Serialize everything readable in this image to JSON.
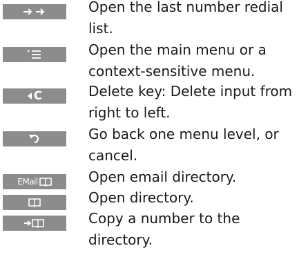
{
  "rows": [
    {
      "key_icon": "redial-arrows-icon",
      "description": "Open the last number redial list."
    },
    {
      "key_icon": "menu-icon",
      "description": "Open the main menu or a context-sensitive menu."
    },
    {
      "key_icon": "delete-key-icon",
      "key_label": "C",
      "description": "Delete key: Delete input from right to left."
    },
    {
      "key_icon": "back-arrow-icon",
      "description": "Go back one menu level, or cancel."
    },
    {
      "key_icon": "email-directory-book-icon",
      "key_label": "EMail",
      "description": "Open email directory."
    },
    {
      "key_icon": "directory-book-icon",
      "description": "Open directory."
    },
    {
      "key_icon": "copy-to-directory-icon",
      "description": "Copy a number to the directory."
    }
  ],
  "colors": {
    "key_background": "#8c8c8c",
    "key_foreground": "#ffffff",
    "text": "#1a1a1a"
  }
}
